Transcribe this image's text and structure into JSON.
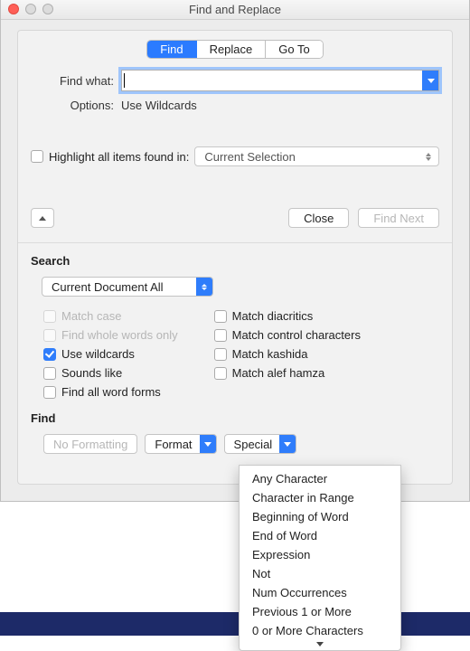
{
  "window": {
    "title": "Find and Replace"
  },
  "tabs": {
    "find": "Find",
    "replace": "Replace",
    "goto": "Go To"
  },
  "labels": {
    "find_what": "Find what:",
    "options": "Options:",
    "options_value": "Use Wildcards",
    "highlight": "Highlight all items found in:",
    "current_selection": "Current Selection",
    "close": "Close",
    "find_next": "Find Next",
    "search_h": "Search",
    "search_scope": "Current Document All",
    "find_h": "Find",
    "no_formatting": "No Formatting",
    "format": "Format",
    "special": "Special"
  },
  "checks_left": [
    {
      "label": "Match case",
      "enabled": false,
      "checked": false
    },
    {
      "label": "Find whole words only",
      "enabled": false,
      "checked": false
    },
    {
      "label": "Use wildcards",
      "enabled": true,
      "checked": true
    },
    {
      "label": "Sounds like",
      "enabled": true,
      "checked": false
    },
    {
      "label": "Find all word forms",
      "enabled": true,
      "checked": false
    }
  ],
  "checks_right": [
    {
      "label": "Match diacritics",
      "checked": false
    },
    {
      "label": "Match control characters",
      "checked": false
    },
    {
      "label": "Match kashida",
      "checked": false
    },
    {
      "label": "Match alef hamza",
      "checked": false
    }
  ],
  "special_menu": [
    "Any Character",
    "Character in Range",
    "Beginning of Word",
    "End of Word",
    "Expression",
    "Not",
    "Num Occurrences",
    "Previous 1 or More",
    "0 or More Characters"
  ]
}
